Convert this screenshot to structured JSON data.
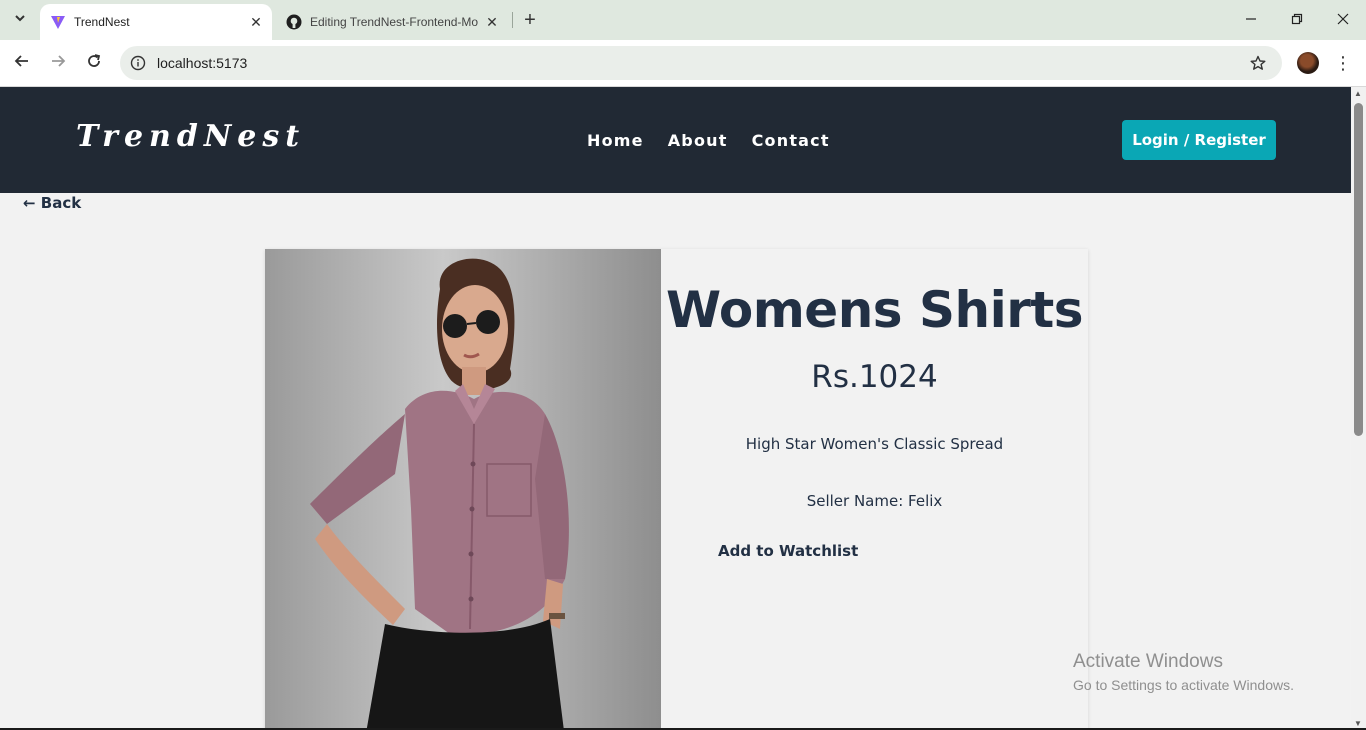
{
  "browser": {
    "tabs": [
      {
        "title": "TrendNest",
        "active": true,
        "icon": "vite-icon"
      },
      {
        "title": "Editing TrendNest-Frontend-Mo",
        "active": false,
        "icon": "github-icon"
      }
    ],
    "url": "localhost:5173"
  },
  "site": {
    "logo": "TrendNest",
    "nav": [
      "Home",
      "About",
      "Contact"
    ],
    "login_label": "Login / Register",
    "back_label": "← Back"
  },
  "product": {
    "title": "Womens Shirts",
    "price": "Rs.1024",
    "description": "High Star Women's Classic Spread",
    "seller": "Seller Name: Felix",
    "watchlist_label": "Add to Watchlist"
  },
  "watermark": {
    "line1": "Activate Windows",
    "line2": "Go to Settings to activate Windows."
  },
  "colors": {
    "header_bg": "#212934",
    "accent": "#0aa7b5",
    "text_dark": "#223044"
  }
}
